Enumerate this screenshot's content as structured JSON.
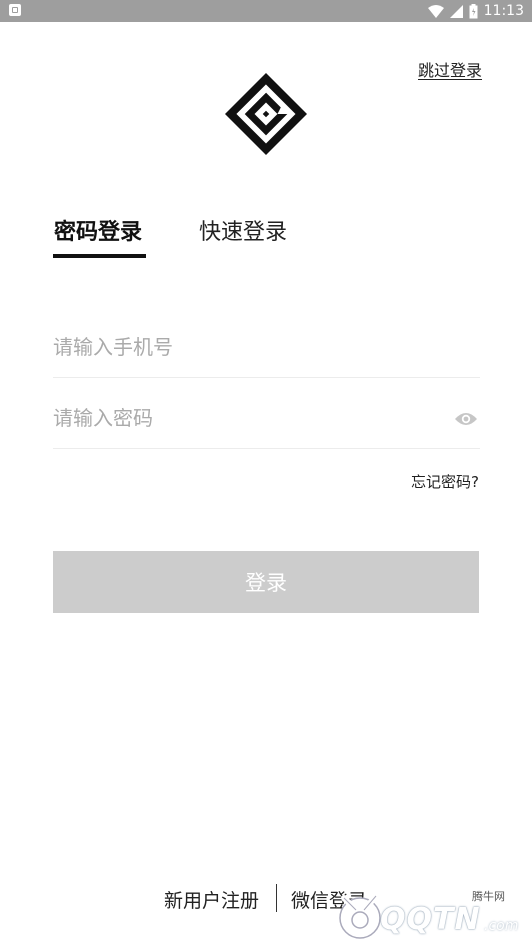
{
  "status_bar": {
    "time": "11:13"
  },
  "header": {
    "skip_label": "跳过登录"
  },
  "tabs": {
    "password_login": "密码登录",
    "quick_login": "快速登录"
  },
  "form": {
    "phone_placeholder": "请输入手机号",
    "password_placeholder": "请输入密码",
    "forgot_label": "忘记密码?",
    "login_label": "登录"
  },
  "footer": {
    "register_label": "新用户注册",
    "wechat_label": "微信登录"
  },
  "watermark": {
    "brand_text": "QQTN",
    "small_text": "腾牛网",
    "domain_text": ".com"
  },
  "colors": {
    "login_button_bg": "#cccccc",
    "status_bar_bg": "#9e9e9e"
  }
}
